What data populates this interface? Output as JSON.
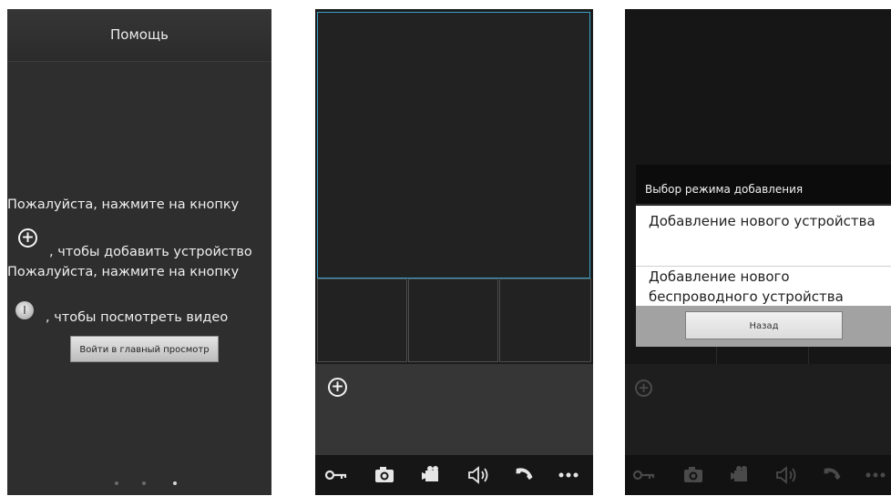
{
  "help": {
    "title": "Помощь",
    "line1": "Пожалуйста, нажмите на кнопку",
    "line2": ", чтобы добавить устройство",
    "line3": "Пожалуйста, нажмите на кнопку",
    "line4": ", чтобы посмотреть видео",
    "enter_button": "Войти в главный просмотр",
    "page_dots": 3,
    "active_dot": 3
  },
  "dialog": {
    "title": "Выбор режима добавления",
    "option_new": "Добавление нового устройства",
    "option_wireless": "Добавление нового беспроводного устройства",
    "back_button": "Назад"
  },
  "toolbar": {
    "icons": [
      "key-icon",
      "camera-icon",
      "video-record-icon",
      "speaker-icon",
      "phone-icon",
      "more-icon"
    ]
  },
  "colors": {
    "selected_cell_border": "#3aa3c8",
    "background": "#2e2e2e"
  }
}
